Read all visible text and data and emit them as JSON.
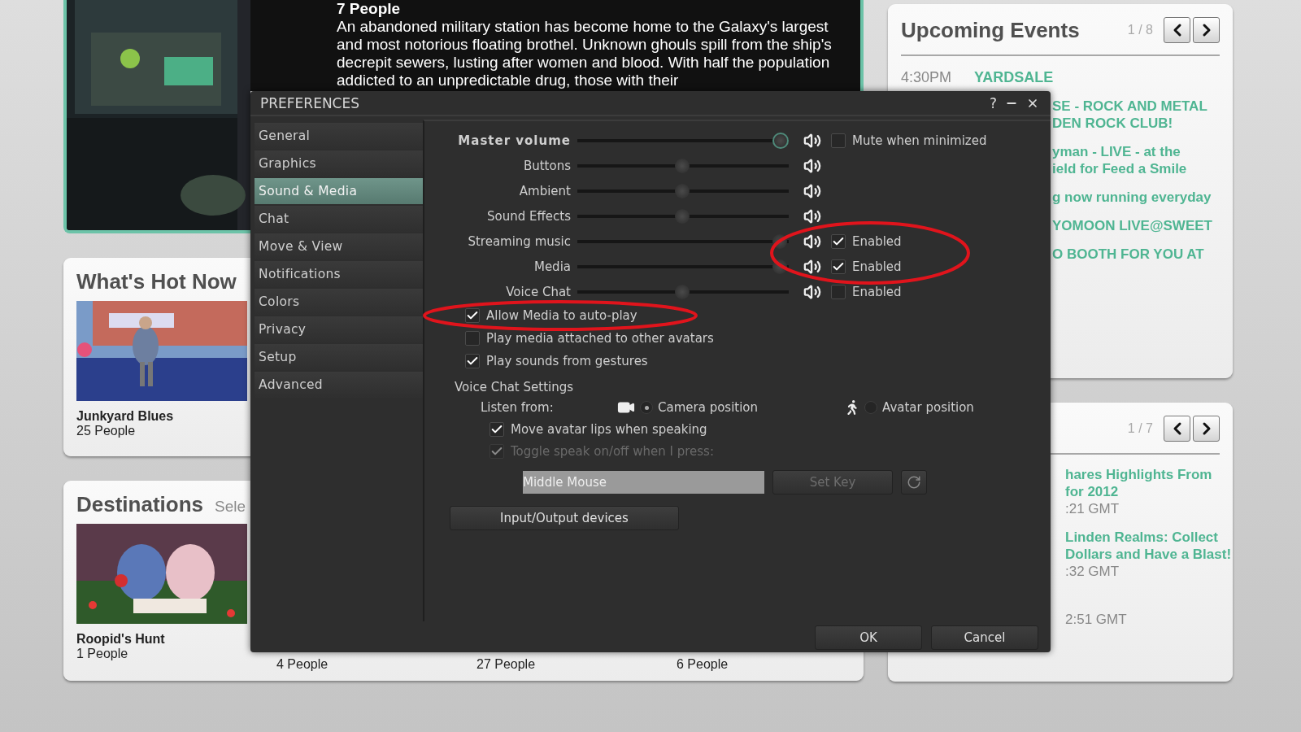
{
  "featured": {
    "people": "7 People",
    "description": "An abandoned military station has become home to the Galaxy's largest and most notorious floating brothel. Unknown ghouls spill from the ship's decrepit sewers, lusting after women and blood. With half the population addicted to an unpredictable drug, those with their"
  },
  "whats_hot": {
    "title": "What's Hot Now",
    "items": [
      {
        "name": "Junkyard Blues",
        "people": "25 People"
      }
    ]
  },
  "destinations": {
    "title": "Destinations",
    "subtitle": "Sele",
    "items": [
      {
        "name": "Roopid's Hunt",
        "people": "1 People"
      },
      {
        "people": "4 People"
      },
      {
        "people": "27 People"
      },
      {
        "people": "6 People"
      }
    ]
  },
  "upcoming": {
    "title": "Upcoming Events",
    "counter": "1 / 8",
    "events": [
      {
        "time": "4:30PM",
        "title": "YARDSALE"
      }
    ],
    "events_partly_covered": [
      {
        "lines": [
          "SE - ROCK AND METAL",
          "DEN ROCK CLUB!"
        ]
      },
      {
        "lines": [
          "yman - LIVE - at the",
          "ield for Feed a Smile"
        ]
      },
      {
        "lines": [
          "g now running everyday"
        ]
      },
      {
        "lines": [
          "YOMOON LIVE@SWEET"
        ]
      },
      {
        "lines": [
          "O BOOTH FOR YOU AT"
        ]
      }
    ]
  },
  "blog": {
    "counter": "1 / 7",
    "posts_partly_covered": [
      {
        "lines": [
          "hares Highlights From",
          "for 2012"
        ],
        "date": ":21 GMT"
      },
      {
        "lines": [
          "Linden Realms: Collect",
          "Dollars and Have a Blast!"
        ],
        "date": ":32 GMT"
      },
      {
        "date": "2:51 GMT"
      }
    ]
  },
  "dialog": {
    "title": "PREFERENCES",
    "help": "?",
    "categories": [
      {
        "label": "General",
        "selected": false
      },
      {
        "label": "Graphics",
        "selected": false
      },
      {
        "label": "Sound & Media",
        "selected": true
      },
      {
        "label": "Chat",
        "selected": false
      },
      {
        "label": "Move & View",
        "selected": false
      },
      {
        "label": "Notifications",
        "selected": false
      },
      {
        "label": "Colors",
        "selected": false
      },
      {
        "label": "Privacy",
        "selected": false
      },
      {
        "label": "Setup",
        "selected": false
      },
      {
        "label": "Advanced",
        "selected": false
      }
    ],
    "volume_rows": [
      {
        "label": "Master volume",
        "kind": "master",
        "level": 1,
        "toggle": {
          "label": "Mute when minimized",
          "checked": false
        }
      },
      {
        "label": "Buttons",
        "kind": "slider",
        "level": 0.5
      },
      {
        "label": "Ambient",
        "kind": "slider",
        "level": 0.5
      },
      {
        "label": "Sound Effects",
        "kind": "slider",
        "level": 0.5
      },
      {
        "label": "Streaming music",
        "kind": "slider",
        "level": 1,
        "toggle": {
          "label": "Enabled",
          "checked": true
        }
      },
      {
        "label": "Media",
        "kind": "slider",
        "level": 1,
        "toggle": {
          "label": "Enabled",
          "checked": true
        }
      },
      {
        "label": "Voice Chat",
        "kind": "slider",
        "level": 0.5,
        "toggle": {
          "label": "Enabled",
          "checked": false
        }
      }
    ],
    "media_options": [
      {
        "label": "Allow Media to auto-play",
        "checked": true
      },
      {
        "label": "Play media attached to other avatars",
        "checked": false
      },
      {
        "label": "Play sounds from gestures",
        "checked": true
      }
    ],
    "voice": {
      "heading": "Voice Chat Settings",
      "listen_label": "Listen from:",
      "positions": [
        {
          "label": "Camera position",
          "kind": "camera",
          "selected": true
        },
        {
          "label": "Avatar position",
          "kind": "avatar",
          "selected": false
        }
      ],
      "options": [
        {
          "label": "Move avatar lips when speaking",
          "checked": true,
          "disabled": false
        },
        {
          "label": "Toggle speak on/off when I press:",
          "checked": true,
          "disabled": true
        }
      ],
      "key_value": "Middle Mouse",
      "set_key": {
        "label": "Set Key",
        "disabled": true
      }
    },
    "devices_button": "Input/Output devices",
    "buttons": [
      "OK",
      "Cancel"
    ]
  }
}
